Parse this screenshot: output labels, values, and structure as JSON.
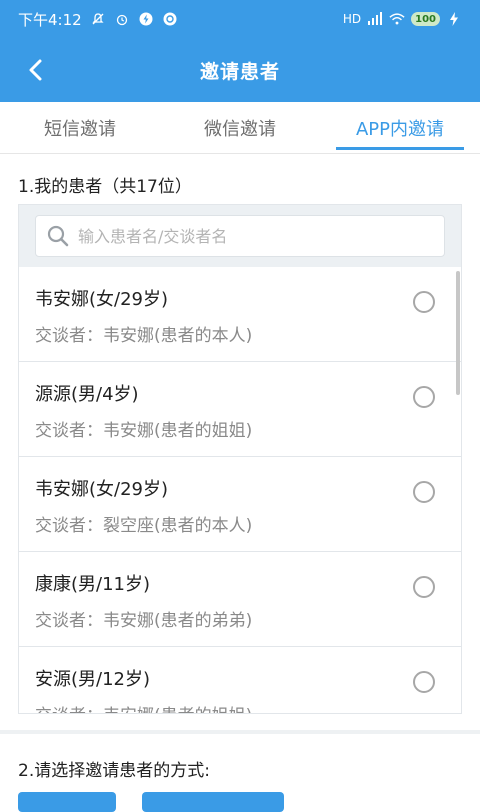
{
  "status_bar": {
    "time": "下午4:12",
    "network": "HD",
    "battery": "100"
  },
  "header": {
    "title": "邀请患者"
  },
  "tabs": [
    {
      "label": "短信邀请",
      "active": false
    },
    {
      "label": "微信邀请",
      "active": false
    },
    {
      "label": "APP内邀请",
      "active": true
    }
  ],
  "section1": {
    "title": "1.我的患者（共17位）"
  },
  "search": {
    "placeholder": "输入患者名/交谈者名",
    "value": ""
  },
  "patients": [
    {
      "name": "韦安娜(女/29岁)",
      "talker": "交谈者：韦安娜(患者的本人)"
    },
    {
      "name": "源源(男/4岁)",
      "talker": "交谈者：韦安娜(患者的姐姐)"
    },
    {
      "name": "韦安娜(女/29岁)",
      "talker": "交谈者：裂空座(患者的本人)"
    },
    {
      "name": "康康(男/11岁)",
      "talker": "交谈者：韦安娜(患者的弟弟)"
    },
    {
      "name": "安源(男/12岁)",
      "talker": "交谈者：韦安娜(患者的姐姐)"
    }
  ],
  "section2": {
    "title": "2.请选择邀请患者的方式:"
  },
  "colors": {
    "primary": "#3a9be6",
    "text": "#222222",
    "muted": "#8a8a8a"
  }
}
